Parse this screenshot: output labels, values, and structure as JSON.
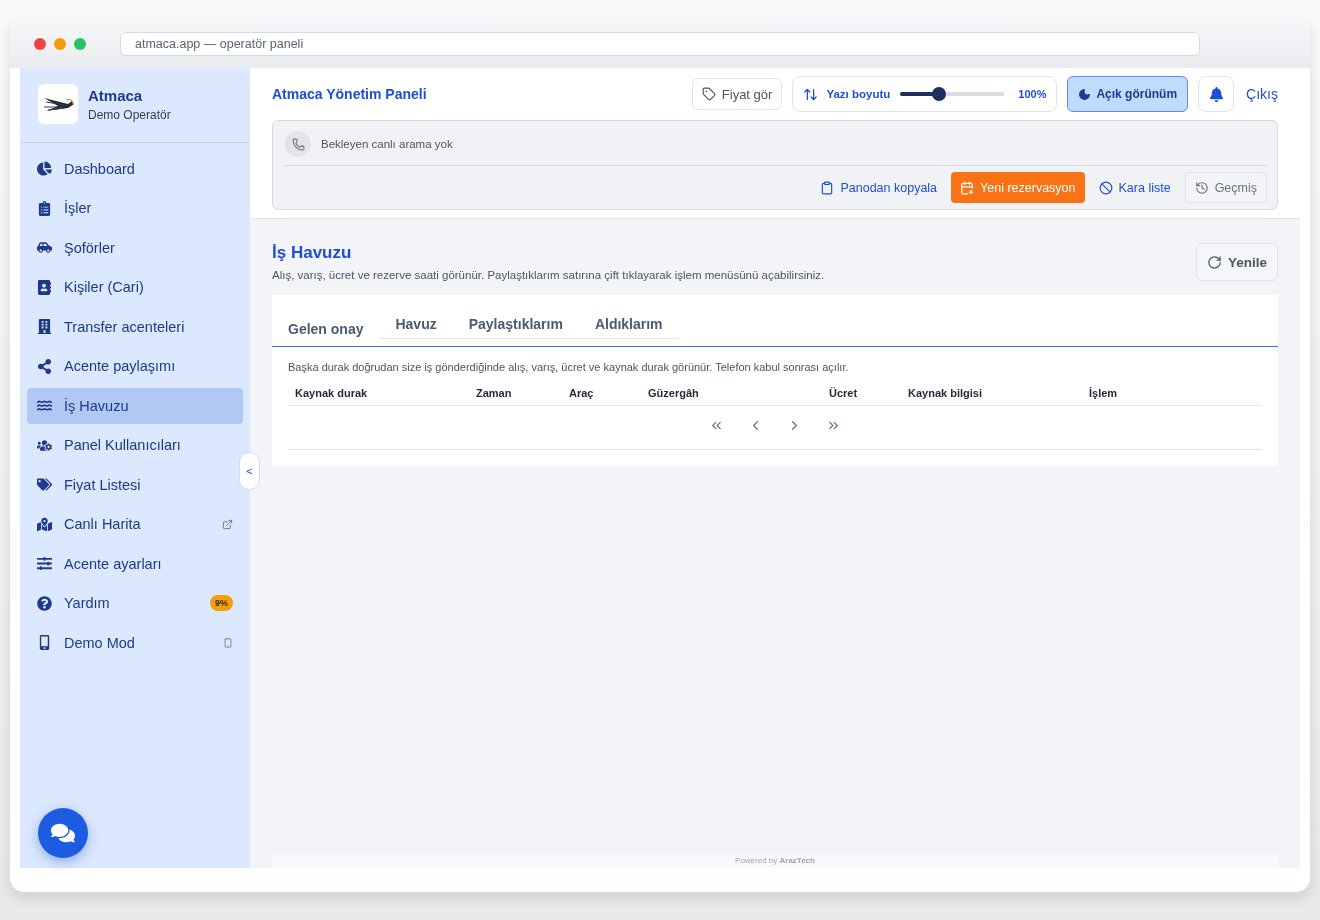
{
  "browser": {
    "address": "atmaca.app — operatör paneli"
  },
  "sidebar": {
    "brand": "Atmaca",
    "role": "Demo Operatör",
    "items": [
      {
        "label": "Dashboard",
        "selected": false,
        "kind": "plain"
      },
      {
        "label": "İşler",
        "selected": false,
        "kind": "plain"
      },
      {
        "label": "Şoförler",
        "selected": false,
        "kind": "plain"
      },
      {
        "label": "Kişiler (Cari)",
        "selected": false,
        "kind": "plain"
      },
      {
        "label": "Transfer acenteleri",
        "selected": false,
        "kind": "plain"
      },
      {
        "label": "Acente paylaşımı",
        "selected": false,
        "kind": "plain"
      },
      {
        "label": "İş Havuzu",
        "selected": true,
        "kind": "plain"
      },
      {
        "label": "Panel Kullanıcıları",
        "selected": false,
        "kind": "plain"
      },
      {
        "label": "Fiyat Listesi",
        "selected": false,
        "kind": "plain"
      },
      {
        "label": "Canlı Harita",
        "selected": false,
        "kind": "external"
      },
      {
        "label": "Acente ayarları",
        "selected": false,
        "kind": "plain"
      },
      {
        "label": "Yardım",
        "selected": false,
        "kind": "badge",
        "badge": "9%"
      },
      {
        "label": "Demo Mod",
        "selected": false,
        "kind": "device"
      }
    ],
    "collapse": "<"
  },
  "header": {
    "title": "Atmaca Yönetim Paneli",
    "price_button": "Fiyat gör",
    "font_size": {
      "label": "Yazı boyutu",
      "level": 0.35,
      "reading": "100%"
    },
    "theme_button": {
      "label": "Açık görünüm",
      "selected": true
    },
    "logout": "Çıkış"
  },
  "call_bar": {
    "status": "Bekleyen canlı arama yok",
    "actions": [
      {
        "label": "Panodan kopyala",
        "kind": "link"
      },
      {
        "label": "Yeni rezervasyon",
        "kind": "primary"
      },
      {
        "label": "Kara liste",
        "kind": "link"
      },
      {
        "label": "Geçmiş",
        "kind": "outline"
      }
    ]
  },
  "page": {
    "title": "İş Havuzu",
    "subtitle": "Alış, varış, ücret ve rezerve saati görünür. Paylaştıklarım satırına çift tıklayarak işlem menüsünü açabilirsiniz.",
    "refresh": "Yenile",
    "tabs": [
      {
        "label": "Gelen onay",
        "selected": true
      },
      {
        "label": "Havuz",
        "selected": false
      },
      {
        "label": "Paylaştıklarım",
        "selected": false
      },
      {
        "label": "Aldıklarım",
        "selected": false
      }
    ],
    "note": "Başka durak doğrudan size iş gönderdiğinde alış, varış, ücret ve kaynak durak görünür. Telefon kabul sonrası açılır.",
    "table": {
      "columns": [
        "Kaynak durak",
        "Zaman",
        "Araç",
        "Güzergâh",
        "Ücret",
        "Kaynak bilgisi",
        "İşlem"
      ]
    }
  },
  "footer": "Powered by **ArazTech**"
}
